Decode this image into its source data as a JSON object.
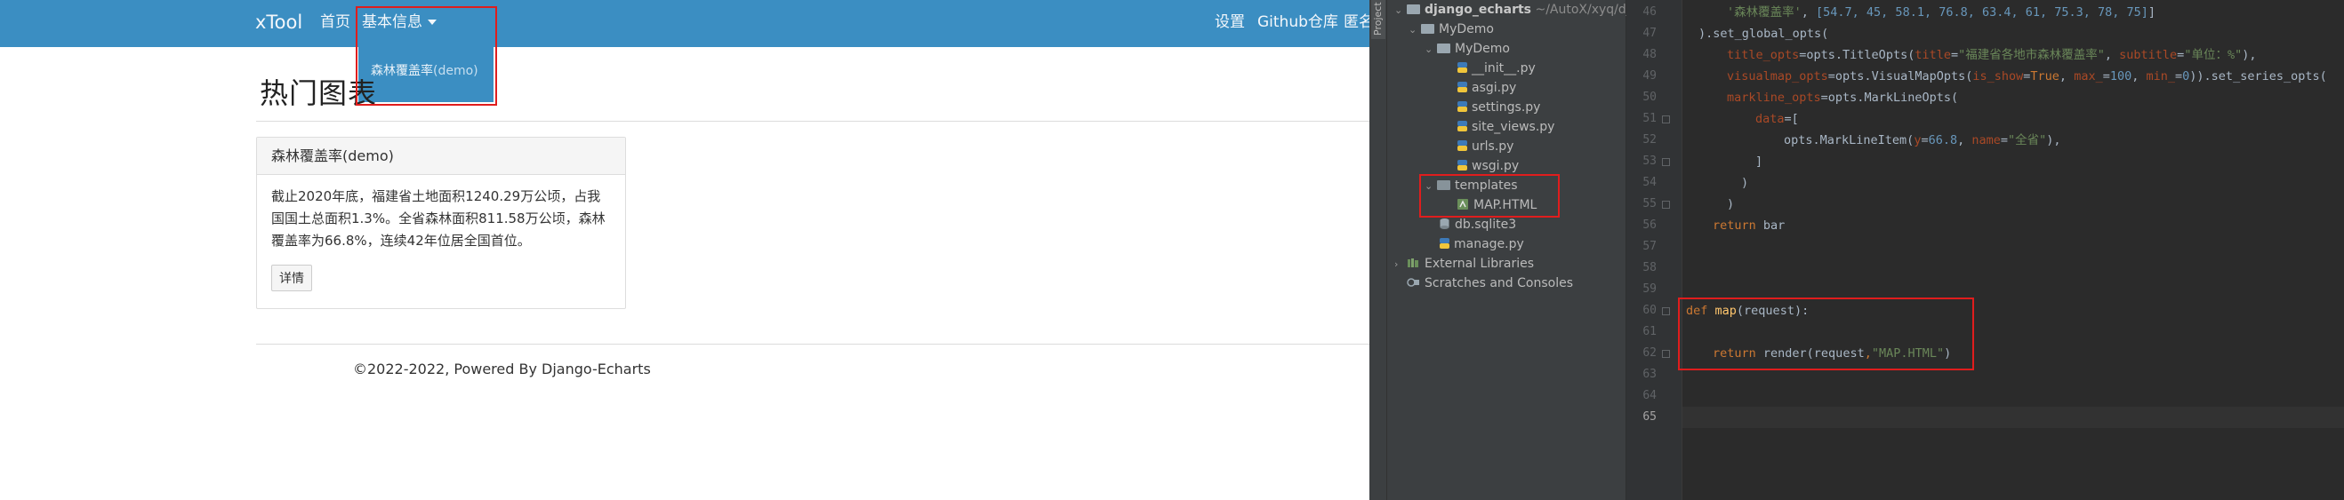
{
  "web": {
    "navbar": {
      "brand": "xTool",
      "home": "首页",
      "basic_info": "基本信息",
      "settings": "设置",
      "github": "Github仓库",
      "more": "匿名"
    },
    "dropdown": {
      "item_main": "森林覆盖率",
      "item_suffix": "(demo)"
    },
    "page_title": "热门图表",
    "panel": {
      "heading": "森林覆盖率(demo)",
      "body": "截止2020年底，福建省土地面积1240.29万公顷，占我国国土总面积1.3%。全省森林面积811.58万公顷，森林覆盖率为66.8%，连续42年位居全国首位。",
      "button": "详情"
    },
    "footer": "©2022-2022, Powered By Django-Echarts"
  },
  "ide": {
    "tool_tab": "Project",
    "tree": {
      "root_name": "django_echarts",
      "root_path": "~/AutoX/xyq/dj",
      "mydemo_outer": "MyDemo",
      "mydemo_inner": "MyDemo",
      "files_inner": [
        "__init__.py",
        "asgi.py",
        "settings.py",
        "site_views.py",
        "urls.py",
        "wsgi.py"
      ],
      "templates": "templates",
      "map_html": "MAP.HTML",
      "db": "db.sqlite3",
      "manage": "manage.py",
      "external": "External Libraries",
      "scratches": "Scratches and Consoles"
    },
    "line_numbers": [
      "46",
      "47",
      "48",
      "49",
      "50",
      "51",
      "52",
      "53",
      "54",
      "55",
      "56",
      "57",
      "58",
      "59",
      "60",
      "61",
      "62",
      "63",
      "64",
      "65"
    ],
    "code": {
      "l46_str": "'森林覆盖率'",
      "l46_rest": "[54.7, 45, 58.1, 76.8, 63.4, 61, 75.3, 78, 75]",
      "l47": ").set_global_opts(",
      "l48_param": "title_opts",
      "l48_mid": "=opts.TitleOpts(",
      "l48_p1": "title",
      "l48_s1": "\"福建省各地市森林覆盖率\"",
      "l48_p2": "subtitle",
      "l48_s2": "\"单位：%\"",
      "l48_end": "),",
      "l49_param": "visualmap_opts",
      "l49_mid": "=opts.VisualMapOpts(",
      "l49_p1": "is_show",
      "l49_k1": "True",
      "l49_p2": "max_",
      "l49_n1": "100",
      "l49_p3": "min_",
      "l49_n2": "0",
      "l49_end": ")).set_series_opts(",
      "l50_param": "markline_opts",
      "l50_mid": "=opts.MarkLineOpts(",
      "l51_param": "data",
      "l51_end": "=[",
      "l52_mid": "opts.MarkLineItem(",
      "l52_p1": "y",
      "l52_n1": "66.8",
      "l52_p2": "name",
      "l52_s1": "\"全省\"",
      "l52_end": "),",
      "l53": "]",
      "l54": ")",
      "l55": ")",
      "l56_kw": "return",
      "l56_rest": " bar",
      "l60_kw": "def",
      "l60_fn": "map",
      "l60_rest": "(request):",
      "l62_kw": "return",
      "l62_rest": " render(request",
      "l62_comma": ",",
      "l62_str": "\"MAP.HTML\"",
      "l62_end": ")"
    }
  }
}
